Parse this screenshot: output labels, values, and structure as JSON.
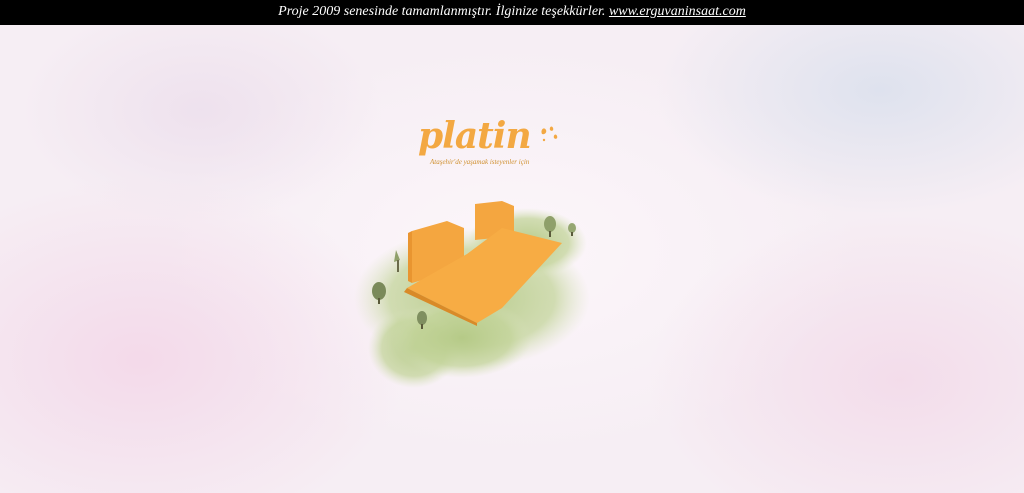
{
  "notice": {
    "text": "Proje 2009 senesinde tamamlanmıştır. İlginize teşekkürler.",
    "link_text": "www.erguvaninsaat.com"
  },
  "logo": {
    "word": "platin",
    "tagline": "Ataşehir'de yaşamak isteyenler için"
  },
  "colors": {
    "brand_orange": "#f3a842",
    "bar_background": "#000000",
    "bar_text": "#ffffff",
    "greenery": "#a9c27a"
  }
}
